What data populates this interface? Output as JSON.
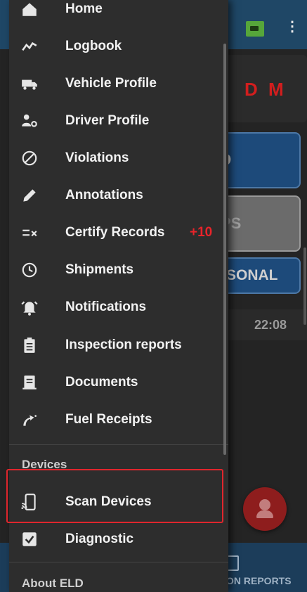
{
  "background": {
    "status_initials": "D M",
    "duty_buttons": {
      "driving": "D",
      "sleeper": "PS",
      "personal": "SONAL"
    },
    "time": "22:08",
    "bottom_tab_label": "ON REPORTS"
  },
  "menu": {
    "items": [
      {
        "label": "Home",
        "icon": "home-icon"
      },
      {
        "label": "Logbook",
        "icon": "trend-icon"
      },
      {
        "label": "Vehicle Profile",
        "icon": "truck-icon"
      },
      {
        "label": "Driver Profile",
        "icon": "driver-icon"
      },
      {
        "label": "Violations",
        "icon": "block-icon"
      },
      {
        "label": "Annotations",
        "icon": "pencil-icon"
      },
      {
        "label": "Certify Records",
        "icon": "certify-icon",
        "badge": "+10"
      },
      {
        "label": "Shipments",
        "icon": "clock-icon"
      },
      {
        "label": "Notifications",
        "icon": "bell-icon"
      },
      {
        "label": "Inspection reports",
        "icon": "clipboard-icon"
      },
      {
        "label": "Documents",
        "icon": "document-icon"
      },
      {
        "label": "Fuel Receipts",
        "icon": "fuel-icon"
      }
    ],
    "devices_section": "Devices",
    "devices_items": [
      {
        "label": "Scan Devices",
        "icon": "device-scan-icon"
      },
      {
        "label": "Diagnostic",
        "icon": "checkbox-icon"
      }
    ],
    "about_section": "About ELD"
  },
  "colors": {
    "drawer_bg": "#2d2d2d",
    "app_bar": "#1f4766",
    "badge_red": "#e8242a",
    "highlight_red": "#e0262d",
    "duty_blue": "#1d4a7a"
  }
}
